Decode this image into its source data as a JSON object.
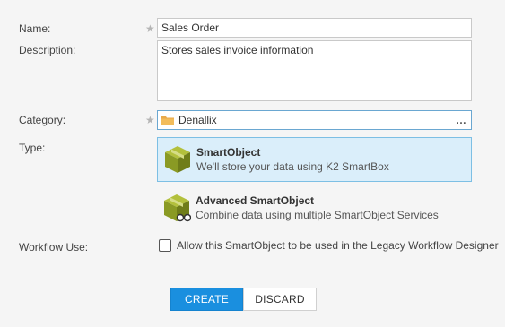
{
  "form": {
    "name_label": "Name:",
    "name_value": "Sales Order",
    "description_label": "Description:",
    "description_value": "Stores sales invoice information",
    "category_label": "Category:",
    "category_value": "Denallix",
    "category_more": "…",
    "type_label": "Type:",
    "workflow_label": "Workflow Use:",
    "required_mark": "★"
  },
  "types": [
    {
      "title": "SmartObject",
      "subtitle": "We'll store your data using K2 SmartBox",
      "icon": "smartobject-cube-icon",
      "selected": true
    },
    {
      "title": "Advanced SmartObject",
      "subtitle": "Combine data using multiple SmartObject Services",
      "icon": "advanced-smartobject-icon",
      "selected": false
    }
  ],
  "workflow": {
    "checkbox_label": "Allow this SmartObject to be used in the Legacy Workflow Designer",
    "checked": false
  },
  "buttons": {
    "create": "CREATE",
    "discard": "DISCARD"
  },
  "colors": {
    "primary": "#1a8fdf",
    "selected_bg": "#daeefa",
    "cube_green": "#8a9a24"
  }
}
